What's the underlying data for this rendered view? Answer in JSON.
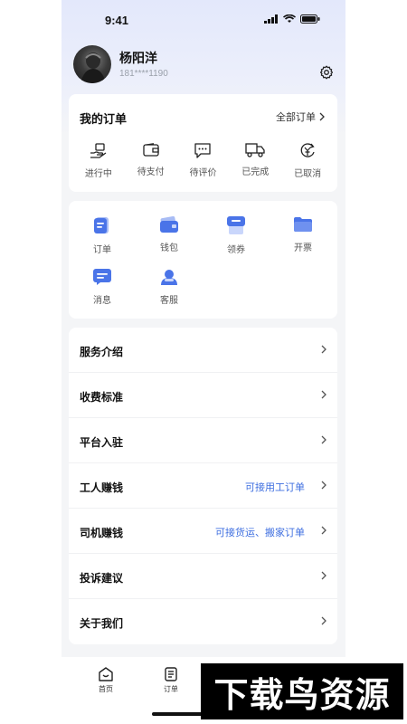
{
  "status_bar": {
    "time": "9:41"
  },
  "profile": {
    "name": "杨阳洋",
    "phone": "181****1190"
  },
  "orders": {
    "title": "我的订单",
    "all_label": "全部订单",
    "items": [
      {
        "label": "进行中",
        "icon": "hand-box-icon"
      },
      {
        "label": "待支付",
        "icon": "wallet-icon"
      },
      {
        "label": "待评价",
        "icon": "comment-icon"
      },
      {
        "label": "已完成",
        "icon": "truck-icon"
      },
      {
        "label": "已取消",
        "icon": "yen-cancel-icon"
      }
    ]
  },
  "services": [
    {
      "label": "订单",
      "icon": "order-icon"
    },
    {
      "label": "钱包",
      "icon": "wallet-card-icon"
    },
    {
      "label": "领券",
      "icon": "coupon-icon"
    },
    {
      "label": "开票",
      "icon": "folder-icon"
    },
    {
      "label": "消息",
      "icon": "message-icon"
    },
    {
      "label": "客服",
      "icon": "customer-service-icon"
    }
  ],
  "menu": [
    {
      "label": "服务介绍",
      "value": ""
    },
    {
      "label": "收费标准",
      "value": ""
    },
    {
      "label": "平台入驻",
      "value": ""
    },
    {
      "label": "工人赚钱",
      "value": "可接用工订单"
    },
    {
      "label": "司机赚钱",
      "value": "可接货运、搬家订单"
    },
    {
      "label": "投诉建议",
      "value": ""
    },
    {
      "label": "关于我们",
      "value": ""
    }
  ],
  "tabbar": [
    {
      "label": "首页"
    },
    {
      "label": "订单"
    }
  ],
  "watermark": "下载鸟资源",
  "colors": {
    "accent": "#3f6fe0",
    "icon_blue": "#4a74e8"
  }
}
